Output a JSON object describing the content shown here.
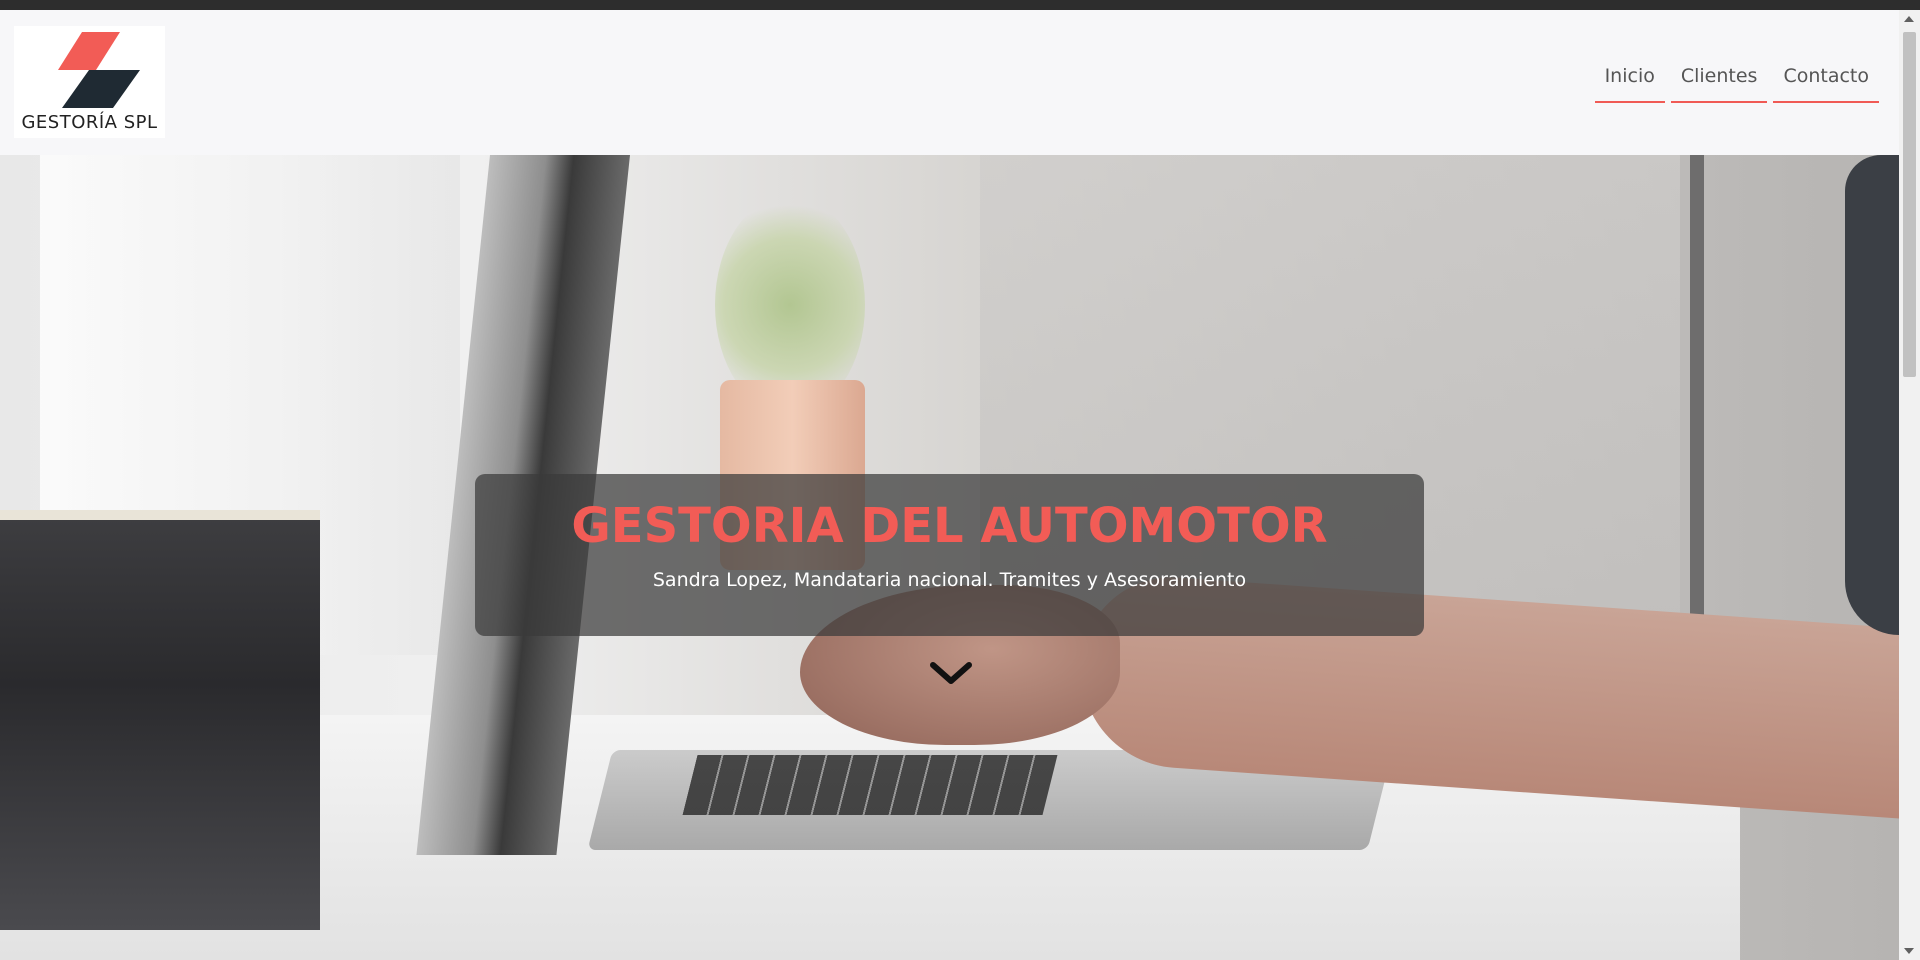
{
  "logo": {
    "text": "GESTORÍA SPL",
    "colors": {
      "red": "#f25c56",
      "dark": "#1f2a33"
    }
  },
  "nav": {
    "items": [
      {
        "label": "Inicio"
      },
      {
        "label": "Clientes"
      },
      {
        "label": "Contacto"
      }
    ],
    "underline_color": "#f05a55"
  },
  "hero": {
    "title": "GESTORIA DEL AUTOMOTOR",
    "subtitle": "Sandra Lopez, Mandataria nacional. Tramites y Asesoramiento",
    "title_color": "#f25c56",
    "scroll_icon": "chevron-down-icon"
  }
}
